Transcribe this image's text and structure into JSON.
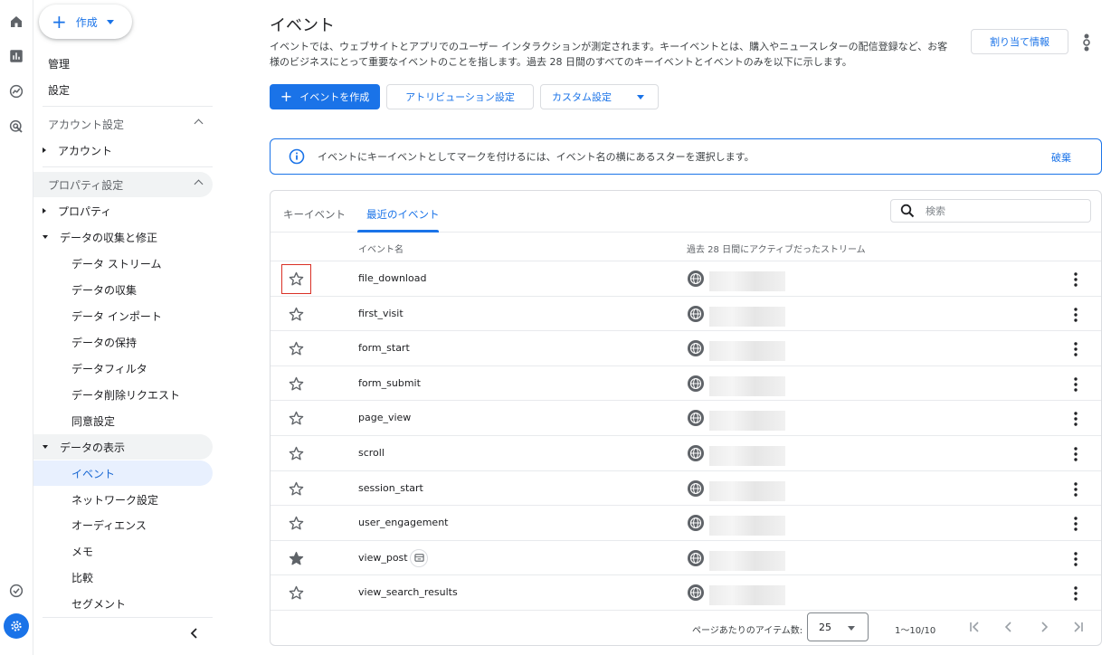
{
  "rail": {
    "icons": [
      "home-icon",
      "reports-icon",
      "explore-icon",
      "advertising-icon",
      "checklist-icon",
      "settings-icon"
    ]
  },
  "sidebar": {
    "create_label": "作成",
    "top_items": [
      {
        "label": "管理"
      },
      {
        "label": "設定"
      }
    ],
    "account_section": "アカウント設定",
    "account_item": "アカウント",
    "property_section": "プロパティ設定",
    "property_item": "プロパティ",
    "data_collection_group": "データの収集と修正",
    "data_collection_items": [
      {
        "label": "データ ストリーム"
      },
      {
        "label": "データの収集"
      },
      {
        "label": "データ インポート"
      },
      {
        "label": "データの保持"
      },
      {
        "label": "データフィルタ"
      },
      {
        "label": "データ削除リクエスト"
      },
      {
        "label": "同意設定"
      }
    ],
    "data_display_group": "データの表示",
    "data_display_items": [
      {
        "label": "イベント",
        "active": true
      },
      {
        "label": "ネットワーク設定"
      },
      {
        "label": "オーディエンス"
      },
      {
        "label": "メモ"
      },
      {
        "label": "比較"
      },
      {
        "label": "セグメント"
      }
    ]
  },
  "header": {
    "title": "イベント",
    "description": "イベントでは、ウェブサイトとアプリでのユーザー インタラクションが測定されます。キーイベントとは、購入やニュースレターの配信登録など、お客様のビジネスにとって重要なイベントのことを指します。過去 28 日間のすべてのキーイベントとイベントのみを以下に示します。",
    "assign_button": "割り当て情報"
  },
  "toolbar": {
    "create_event": "イベントを作成",
    "attribution": "アトリビューション設定",
    "custom": "カスタム設定"
  },
  "banner": {
    "message": "イベントにキーイベントとしてマークを付けるには、イベント名の横にあるスターを選択します。",
    "dismiss": "破棄"
  },
  "tabs": [
    {
      "label": "キーイベント",
      "active": false
    },
    {
      "label": "最近のイベント",
      "active": true
    }
  ],
  "search": {
    "placeholder": "検索",
    "value": ""
  },
  "table": {
    "columns": [
      "イベント名",
      "過去 28 日間にアクティブだったストリーム"
    ],
    "rows": [
      {
        "name": "file_download",
        "starred": false,
        "highlighted": true
      },
      {
        "name": "first_visit",
        "starred": false
      },
      {
        "name": "form_start",
        "starred": false
      },
      {
        "name": "form_submit",
        "starred": false
      },
      {
        "name": "page_view",
        "starred": false
      },
      {
        "name": "scroll",
        "starred": false
      },
      {
        "name": "session_start",
        "starred": false
      },
      {
        "name": "user_engagement",
        "starred": false
      },
      {
        "name": "view_post",
        "starred": true,
        "badge": true
      },
      {
        "name": "view_search_results",
        "starred": false
      }
    ]
  },
  "pagination": {
    "per_page_label": "ページあたりのアイテム数:",
    "per_page_value": "25",
    "range": "1〜10/10"
  },
  "colors": {
    "accent": "#1a73e8",
    "highlight": "#d93025"
  }
}
